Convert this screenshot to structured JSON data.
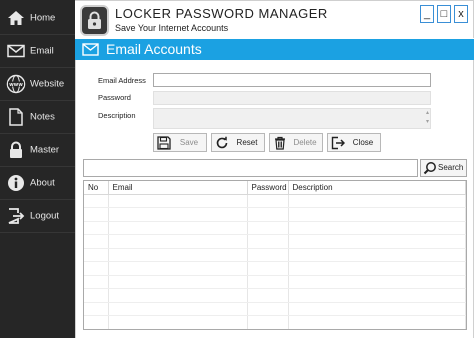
{
  "sidebar": {
    "items": [
      {
        "label": "Home",
        "icon": "home-icon"
      },
      {
        "label": "Email",
        "icon": "email-icon"
      },
      {
        "label": "Website",
        "icon": "globe-www-icon"
      },
      {
        "label": "Notes",
        "icon": "notes-icon"
      },
      {
        "label": "Master",
        "icon": "lock-icon"
      },
      {
        "label": "About",
        "icon": "info-icon"
      },
      {
        "label": "Logout",
        "icon": "logout-icon"
      }
    ]
  },
  "titlebar": {
    "title": "LOCKER PASSWORD MANAGER",
    "subtitle": "Save Your Internet Accounts",
    "minimize": "_",
    "maximize": "□",
    "close": "x"
  },
  "section": {
    "title": "Email Accounts",
    "icon": "envelope-icon"
  },
  "form": {
    "email_label": "Email Address",
    "email_value": "",
    "password_label": "Password",
    "password_value": "",
    "description_label": "Description",
    "description_value": ""
  },
  "buttons": {
    "save": "Save",
    "reset": "Reset",
    "delete": "Delete",
    "close": "Close"
  },
  "search": {
    "value": "",
    "button": "Search"
  },
  "table": {
    "columns": [
      "No",
      "Email",
      "Password",
      "Description"
    ],
    "rows": []
  },
  "colors": {
    "sidebar": "#262626",
    "accent": "#1ba1e2",
    "window_border": "#3a8fd6"
  }
}
